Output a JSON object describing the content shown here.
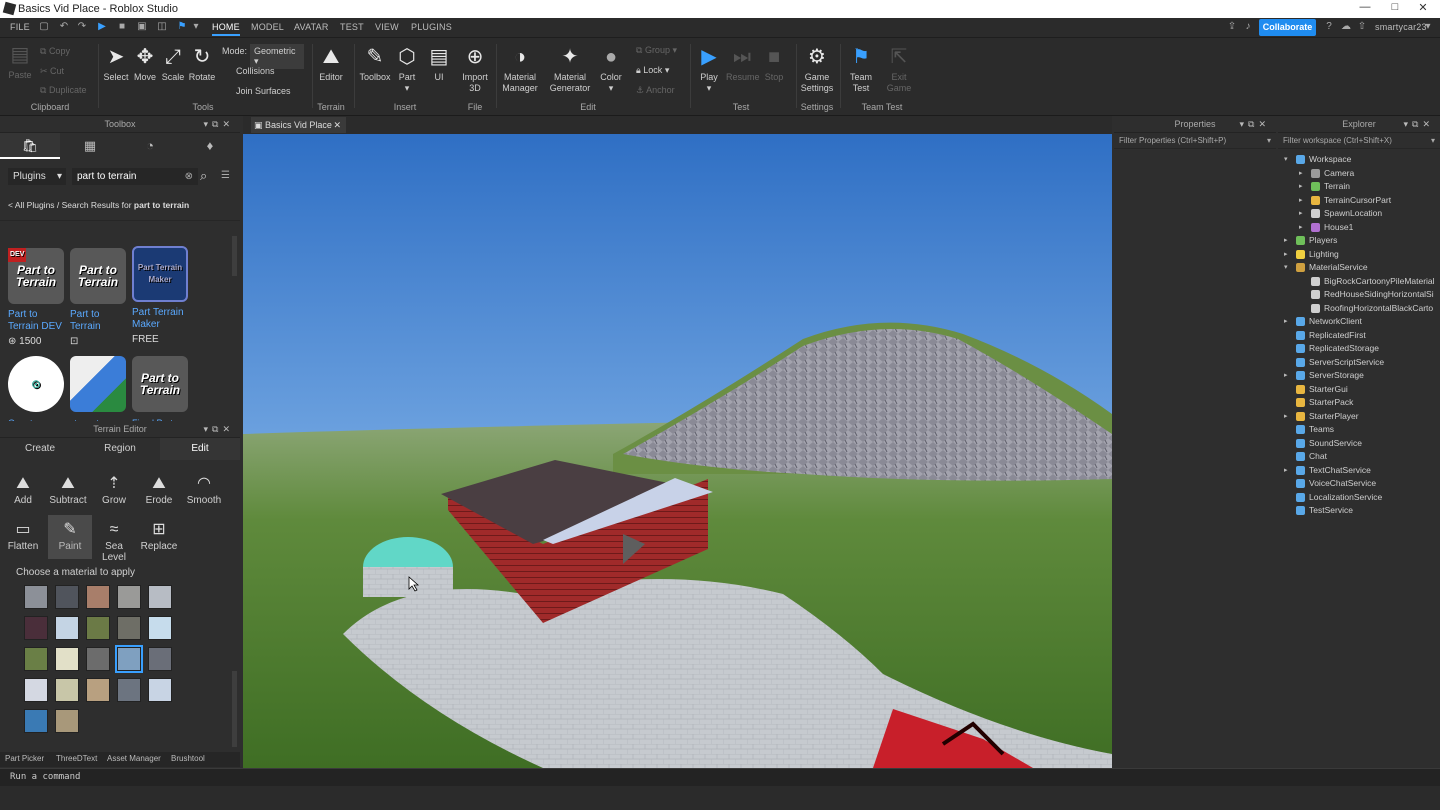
{
  "window": {
    "title": "Basics Vid Place - Roblox Studio",
    "min": "—",
    "max": "□",
    "close": "✕"
  },
  "menubar": {
    "file": "FILE",
    "tabs": [
      "HOME",
      "MODEL",
      "AVATAR",
      "TEST",
      "VIEW",
      "PLUGINS"
    ],
    "collaborate": "Collaborate",
    "username": "smartycar23"
  },
  "ribbon": {
    "clipboard": {
      "paste": "Paste",
      "copy": "Copy",
      "cut": "Cut",
      "duplicate": "Duplicate",
      "group": "Clipboard"
    },
    "tools": {
      "select": "Select",
      "move": "Move",
      "scale": "Scale",
      "rotate": "Rotate",
      "mode_label": "Mode:",
      "mode_value": "Geometric",
      "collisions": "Collisions",
      "join_surfaces": "Join Surfaces",
      "group": "Tools"
    },
    "terrain": {
      "editor": "Editor",
      "group": "Terrain"
    },
    "insert": {
      "toolbox": "Toolbox",
      "part": "Part",
      "ui": "UI",
      "group": "Insert"
    },
    "file": {
      "import3d_1": "Import",
      "import3d_2": "3D",
      "group": "File"
    },
    "edit": {
      "material_manager_1": "Material",
      "material_manager_2": "Manager",
      "material_generator_1": "Material",
      "material_generator_2": "Generator",
      "color": "Color",
      "group_btn": "Group",
      "lock": "Lock",
      "anchor": "Anchor",
      "group": "Edit"
    },
    "test": {
      "play": "Play",
      "resume": "Resume",
      "stop": "Stop",
      "group": "Test"
    },
    "settings": {
      "game_settings_1": "Game",
      "game_settings_2": "Settings",
      "group": "Settings"
    },
    "team_test": {
      "team_test_1": "Team",
      "team_test_2": "Test",
      "exit_game_1": "Exit",
      "exit_game_2": "Game",
      "group": "Team Test"
    }
  },
  "toolbox": {
    "title": "Toolbox",
    "category": "Plugins",
    "search_value": "part to terrain",
    "breadcrumb_prefix": "< All Plugins / Search Results for ",
    "breadcrumb_query": "part to terrain",
    "plugins": [
      {
        "thumb": "Part to Terrain",
        "name1": "Part to",
        "name2": "Terrain DEV",
        "price": "1500",
        "badge": "DEV"
      },
      {
        "thumb": "Part to Terrain",
        "name1": "Part to",
        "name2": "Terrain",
        "price": ""
      },
      {
        "thumb": "Part Terrain Maker",
        "name1": "Part Terrain",
        "name2": "Maker",
        "price": "FREE"
      },
      {
        "thumb": "",
        "name1": "Quantum",
        "name2": ""
      },
      {
        "thumb": "",
        "name1": "stevent",
        "name2": ""
      },
      {
        "thumb": "Part to Terrain",
        "name1": "Fixed Part",
        "name2": ""
      }
    ]
  },
  "terrain_editor": {
    "title": "Terrain Editor",
    "tabs": [
      "Create",
      "Region",
      "Edit"
    ],
    "tools": [
      "Add",
      "Subtract",
      "Grow",
      "Erode",
      "Smooth",
      "Flatten",
      "Paint",
      "Sea Level",
      "Replace"
    ],
    "material_prompt": "Choose a material to apply",
    "materials": [
      "#8c9098",
      "#50545c",
      "#a87e6a",
      "#9a9a98",
      "#b7bcc4",
      "#4a2e3a",
      "#c4d4e4",
      "#6b7a46",
      "#6e6e66",
      "#c6dcec",
      "#6a7f46",
      "#e2e0c8",
      "#6c6c6c",
      "#7fa0c0",
      "#6a6e78",
      "#d4d8e2",
      "#c8c6a8",
      "#b8a080",
      "#6c7480",
      "#c8d4e4",
      "#3a7ab4",
      "#a8987a"
    ]
  },
  "bottom_tabs": [
    "Part Picker",
    "ThreeDText",
    "Asset Manager",
    "Brushtool"
  ],
  "viewport": {
    "tab": "Basics Vid Place"
  },
  "properties": {
    "title": "Properties",
    "filter": "Filter Properties (Ctrl+Shift+P)"
  },
  "explorer": {
    "title": "Explorer",
    "filter": "Filter workspace (Ctrl+Shift+X)",
    "items": [
      {
        "label": "Workspace",
        "level": 0,
        "caret": "▾",
        "color": "#59a8e8"
      },
      {
        "label": "Camera",
        "level": 1,
        "caret": "▸",
        "color": "#9a9a9a"
      },
      {
        "label": "Terrain",
        "level": 1,
        "caret": "▸",
        "color": "#6fbf5a"
      },
      {
        "label": "TerrainCursorPart",
        "level": 1,
        "caret": "▸",
        "color": "#e8b640"
      },
      {
        "label": "SpawnLocation",
        "level": 1,
        "caret": "▸",
        "color": "#cfcfcf"
      },
      {
        "label": "House1",
        "level": 1,
        "caret": "▸",
        "color": "#b070d0"
      },
      {
        "label": "Players",
        "level": 0,
        "caret": "▸",
        "color": "#6fbf5a"
      },
      {
        "label": "Lighting",
        "level": 0,
        "caret": "▸",
        "color": "#f0d040"
      },
      {
        "label": "MaterialService",
        "level": 0,
        "caret": "▾",
        "color": "#cfa040"
      },
      {
        "label": "BigRockCartoonyPileMaterial",
        "level": 1,
        "caret": "",
        "color": "#cfcfcf"
      },
      {
        "label": "RedHouseSidingHorizontalSi",
        "level": 1,
        "caret": "",
        "color": "#cfcfcf"
      },
      {
        "label": "RoofingHorizontalBlackCarto",
        "level": 1,
        "caret": "",
        "color": "#cfcfcf"
      },
      {
        "label": "NetworkClient",
        "level": 0,
        "caret": "▸",
        "color": "#59a8e8"
      },
      {
        "label": "ReplicatedFirst",
        "level": 0,
        "caret": "",
        "color": "#59a8e8"
      },
      {
        "label": "ReplicatedStorage",
        "level": 0,
        "caret": "",
        "color": "#59a8e8"
      },
      {
        "label": "ServerScriptService",
        "level": 0,
        "caret": "",
        "color": "#59a8e8"
      },
      {
        "label": "ServerStorage",
        "level": 0,
        "caret": "▸",
        "color": "#59a8e8"
      },
      {
        "label": "StarterGui",
        "level": 0,
        "caret": "",
        "color": "#e8b640"
      },
      {
        "label": "StarterPack",
        "level": 0,
        "caret": "",
        "color": "#e8b640"
      },
      {
        "label": "StarterPlayer",
        "level": 0,
        "caret": "▸",
        "color": "#e8b640"
      },
      {
        "label": "Teams",
        "level": 0,
        "caret": "",
        "color": "#59a8e8"
      },
      {
        "label": "SoundService",
        "level": 0,
        "caret": "",
        "color": "#59a8e8"
      },
      {
        "label": "Chat",
        "level": 0,
        "caret": "",
        "color": "#59a8e8"
      },
      {
        "label": "TextChatService",
        "level": 0,
        "caret": "▸",
        "color": "#59a8e8"
      },
      {
        "label": "VoiceChatService",
        "level": 0,
        "caret": "",
        "color": "#59a8e8"
      },
      {
        "label": "LocalizationService",
        "level": 0,
        "caret": "",
        "color": "#59a8e8"
      },
      {
        "label": "TestService",
        "level": 0,
        "caret": "",
        "color": "#59a8e8"
      }
    ]
  },
  "command_bar": {
    "placeholder": "Run a command"
  },
  "colors": {
    "accent": "#1f8cf0",
    "panel": "#2e2e2e",
    "link": "#5aa9ff"
  }
}
